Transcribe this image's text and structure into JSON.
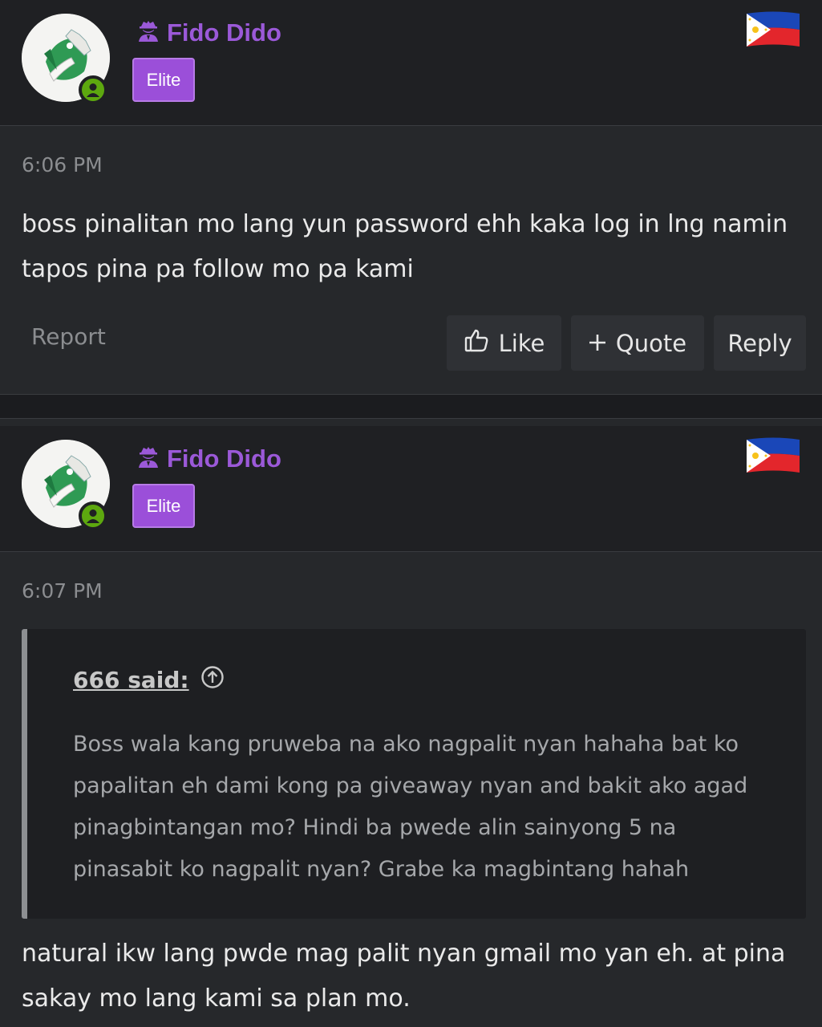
{
  "posts": [
    {
      "username": "Fido Dido",
      "badge": "Elite",
      "time": "6:06 PM",
      "message": "boss pinalitan mo lang yun password ehh kaka log in lng namin tapos pina pa follow mo pa kami",
      "actions": {
        "report": "Report",
        "like": "Like",
        "quote": "Quote",
        "reply": "Reply"
      }
    },
    {
      "username": "Fido Dido",
      "badge": "Elite",
      "time": "6:07 PM",
      "quote": {
        "author": "666 said:",
        "text": "Boss wala kang pruweba na ako nagpalit nyan hahaha bat ko papalitan eh dami kong pa giveaway nyan and bakit ako agad pinagbintangan mo? Hindi ba pwede alin sainyong 5 na pinasabit ko nagpalit nyan? Grabe ka magbintang hahah"
      },
      "message": "natural ikw lang pwde mag palit nyan gmail mo yan eh. at pina sakay mo lang kami sa plan mo."
    }
  ],
  "icons": {
    "user_role": "spy-icon",
    "online": "user-online-icon",
    "flag": "philippines-flag-icon",
    "like": "thumbs-up-icon",
    "quote": "plus-icon",
    "quote_link": "arrow-up-circle-icon"
  },
  "colors": {
    "username": "#9b59d8",
    "badge": "#9b4fd9",
    "online": "#5da80f"
  }
}
